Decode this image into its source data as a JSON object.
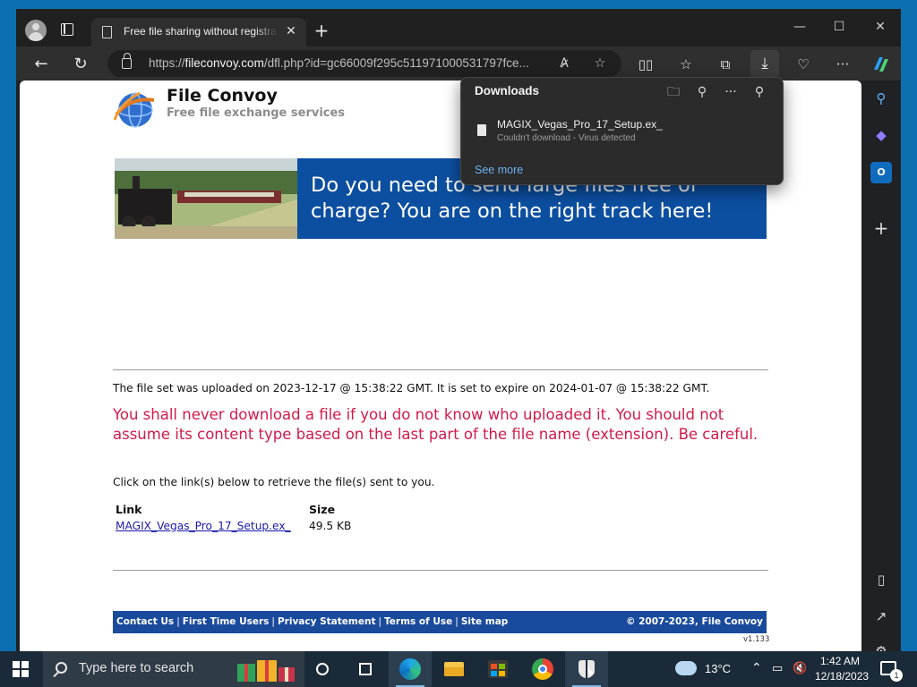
{
  "browser": {
    "tab_title": "Free file sharing without registration",
    "url_prefix": "https://",
    "url_host": "fileconvoy.com",
    "url_rest": "/dfl.php?id=gc66009f295c511971000531797fce..."
  },
  "downloads": {
    "title": "Downloads",
    "items": [
      {
        "name": "MAGIX_Vegas_Pro_17_Setup.ex_",
        "status": "Couldn't download - Virus detected"
      }
    ],
    "see_more": "See more"
  },
  "page": {
    "brand_title": "File Convoy",
    "brand_subtitle": "Free file exchange services",
    "banner_text": "Do you  need to send large files free of charge? You are on the right track here!",
    "upload_info": "The file set was uploaded on 2023-12-17 @ 15:38:22 GMT. It is set to expire on 2024-01-07 @ 15:38:22 GMT.",
    "warning": "You shall never download a file if you do not know who uploaded it. You should not assume its content type based on the last part of the file name (extension). Be careful.",
    "click_info": "Click on the link(s) below to retrieve the file(s) sent to you.",
    "files_table": {
      "headers": [
        "Link",
        "Size"
      ],
      "rows": [
        {
          "link": "MAGIX_Vegas_Pro_17_Setup.ex_",
          "size": "49.5 KB"
        }
      ]
    },
    "footer": {
      "links": [
        "Contact Us",
        "First Time Users",
        "Privacy Statement",
        "Terms of Use",
        "Site map"
      ],
      "copyright": "© 2007-2023, File Convoy",
      "version": "v1.133"
    }
  },
  "taskbar": {
    "search_placeholder": "Type here to search",
    "weather": "13°C",
    "time": "1:42 AM",
    "date": "12/18/2023",
    "notification_count": "1"
  },
  "colors": {
    "warning": "#d11b4a",
    "banner": "#0c4fa0",
    "footer": "#1a4a9c",
    "link": "#1a1aa8",
    "downloads_link": "#6db3f2"
  }
}
